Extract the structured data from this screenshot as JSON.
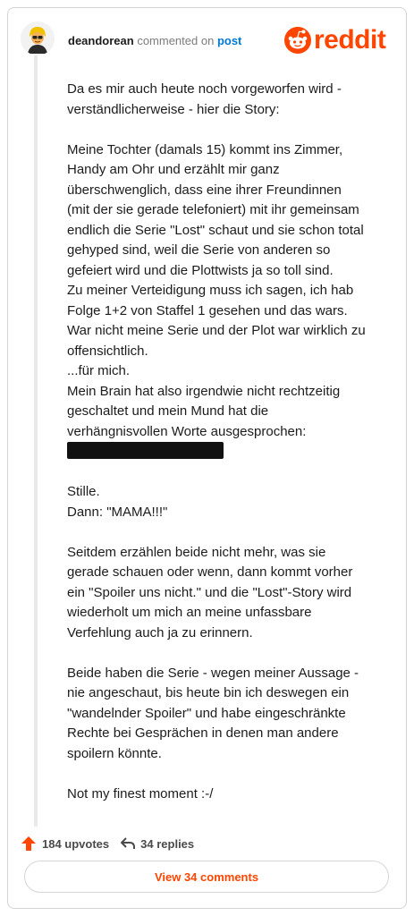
{
  "header": {
    "username": "deandorean",
    "commented_on": "commented on",
    "post_link": "post",
    "logo_text": "reddit"
  },
  "comment": {
    "intro": [
      "Da es mir auch heute noch vorgeworfen wird -",
      "verständlicherweise - hier die Story:"
    ],
    "story": [
      "Meine Tochter (damals 15) kommt ins Zimmer,",
      "Handy am Ohr und erzählt mir ganz",
      "überschwenglich, dass eine ihrer Freundinnen",
      "(mit der sie gerade telefoniert) mit ihr gemeinsam",
      "endlich die Serie \"Lost\" schaut und sie schon total",
      "gehyped sind, weil die Serie von anderen so",
      "gefeiert wird und die Plottwists ja so toll sind.",
      "Zu meiner Verteidigung muss ich sagen, ich hab",
      "Folge 1+2 von Staffel 1 gesehen und das wars.",
      "War nicht meine Serie und der Plot war wirklich zu",
      "offensichtlich.",
      "...für mich.",
      "Mein Brain hat also irgendwie nicht rechtzeitig",
      "geschaltet und mein Mund hat die",
      "verhängnisvollen Worte ausgesprochen:"
    ],
    "reaction": [
      "Stille.",
      "Dann: \"MAMA!!!\""
    ],
    "aftermath": [
      "Seitdem erzählen beide nicht mehr, was sie",
      "gerade schauen oder wenn, dann kommt vorher",
      "ein \"Spoiler uns nicht.\" und die \"Lost\"-Story wird",
      "wiederholt um mich an meine unfassbare",
      "Verfehlung auch ja zu erinnern."
    ],
    "consequence": [
      "Beide haben die Serie - wegen meiner Aussage -",
      "nie angeschaut, bis heute bin ich deswegen ein",
      "\"wandelnder Spoiler\" und habe eingeschränkte",
      "Rechte bei Gesprächen in denen man andere",
      "spoilern könnte."
    ],
    "closing": "Not my finest moment :-/"
  },
  "footer": {
    "upvotes": "184 upvotes",
    "replies": "34 replies",
    "view_comments": "View 34 comments"
  },
  "colors": {
    "brand": "#ff4500",
    "link": "#0079d3"
  },
  "icons": [
    "avatar",
    "reddit-snoo-icon",
    "upvote-arrow-icon",
    "reply-icon"
  ]
}
